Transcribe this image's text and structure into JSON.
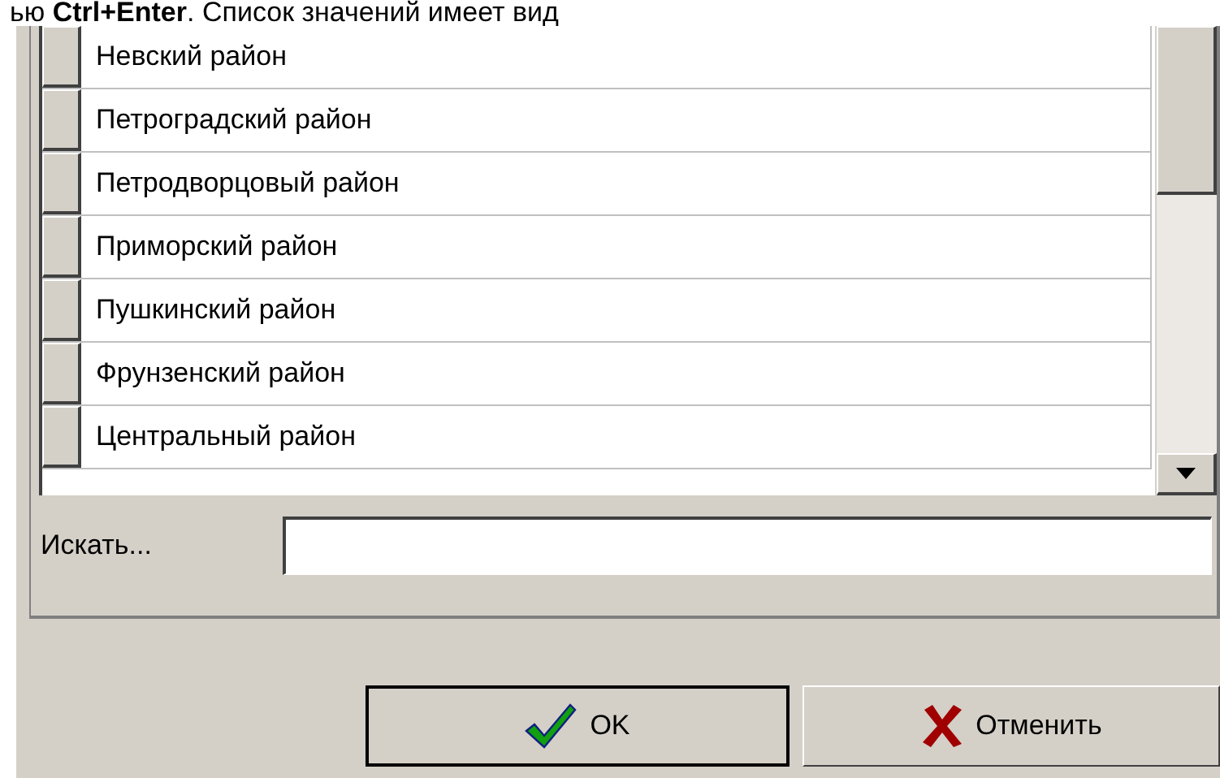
{
  "intro_text": "ью **Ctrl+Enter**. Список значений имеет вид",
  "list": {
    "rows": [
      {
        "label": "Невский район"
      },
      {
        "label": "Петроградский район"
      },
      {
        "label": "Петродворцовый район"
      },
      {
        "label": "Приморский район"
      },
      {
        "label": "Пушкинский район"
      },
      {
        "label": "Фрунзенский район"
      },
      {
        "label": "Центральный район"
      }
    ]
  },
  "search": {
    "label": "Искать..."
  },
  "buttons": [
    {
      "kind": "ok",
      "label": "OK",
      "default": true
    },
    {
      "kind": "cancel",
      "label": "Отменить",
      "default": false
    }
  ]
}
